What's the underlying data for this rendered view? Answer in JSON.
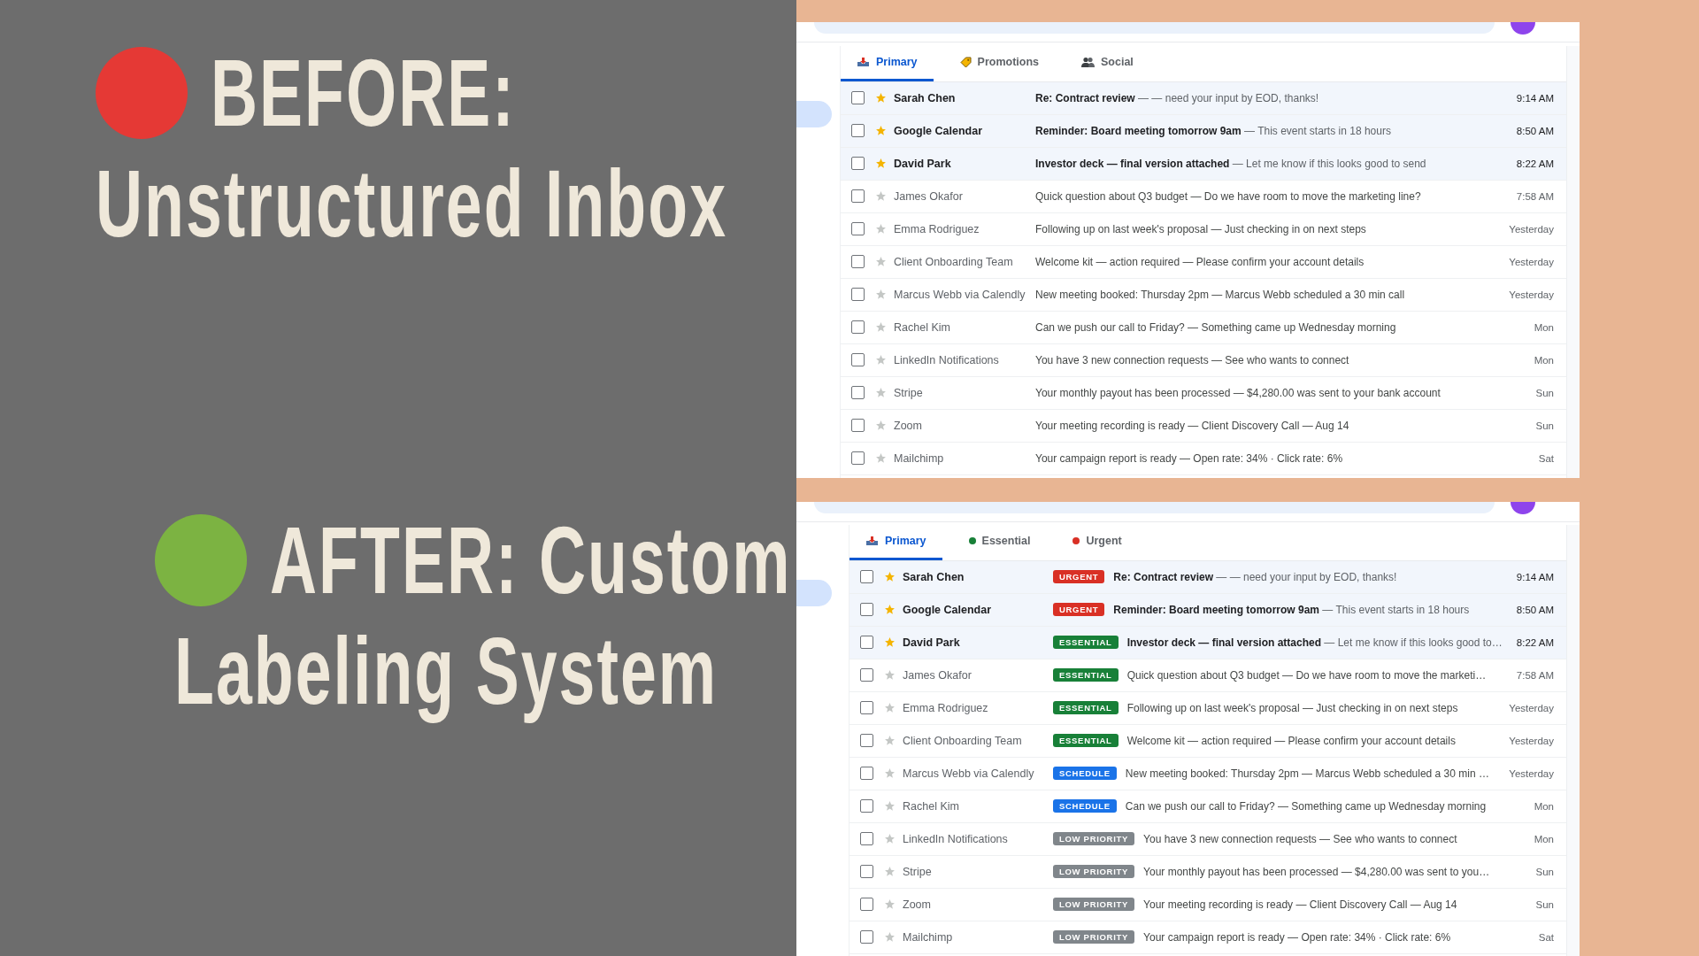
{
  "before": {
    "heading": {
      "color": "#e53935",
      "lines": [
        "BEFORE:",
        "Unstructured Inbox"
      ]
    },
    "inbox": {
      "tabs": [
        {
          "label": "Primary",
          "kind": "inbox",
          "selected": true
        },
        {
          "label": "Promotions",
          "kind": "tag",
          "selected": false
        },
        {
          "label": "Social",
          "kind": "people",
          "selected": false
        }
      ],
      "rows": [
        {
          "checked": false,
          "starred": true,
          "unread": true,
          "sender": "Sarah Chen",
          "text": "**Re: Contract review** — — need your input by EOD, thanks!",
          "time": "9:14 AM"
        },
        {
          "checked": false,
          "starred": true,
          "unread": true,
          "sender": "Google Calendar",
          "text": "**Reminder: Board meeting tomorrow 9am** — This event starts in 18 hours",
          "time": "8:50 AM"
        },
        {
          "checked": false,
          "starred": true,
          "unread": true,
          "sender": "David Park",
          "text": "**Investor deck — final version attached** — Let me know if this looks good to send",
          "time": "8:22 AM"
        },
        {
          "checked": false,
          "starred": false,
          "unread": false,
          "sender": "James Okafor",
          "text": "Quick question about Q3 budget — Do we have room to move the marketing line?",
          "time": "7:58 AM"
        },
        {
          "checked": false,
          "starred": false,
          "unread": false,
          "sender": "Emma Rodriguez",
          "text": "Following up on last week's proposal — Just checking in on next steps",
          "time": "Yesterday"
        },
        {
          "checked": false,
          "starred": false,
          "unread": false,
          "sender": "Client Onboarding Team",
          "text": "Welcome kit — action required — Please confirm your account details",
          "time": "Yesterday"
        },
        {
          "checked": false,
          "starred": false,
          "unread": false,
          "sender": "Marcus Webb via Calendly",
          "text": "New meeting booked: Thursday 2pm — Marcus Webb scheduled a 30 min call",
          "time": "Yesterday"
        },
        {
          "checked": false,
          "starred": false,
          "unread": false,
          "sender": "Rachel Kim",
          "text": "Can we push our call to Friday? — Something came up Wednesday morning",
          "time": "Mon"
        },
        {
          "checked": false,
          "starred": false,
          "unread": false,
          "sender": "LinkedIn Notifications",
          "text": "You have 3 new connection requests — See who wants to connect",
          "time": "Mon"
        },
        {
          "checked": false,
          "starred": false,
          "unread": false,
          "sender": "Stripe",
          "text": "Your monthly payout has been processed — $4,280.00 was sent to your bank account",
          "time": "Sun"
        },
        {
          "checked": false,
          "starred": false,
          "unread": false,
          "sender": "Zoom",
          "text": "Your meeting recording is ready — Client Discovery Call — Aug 14",
          "time": "Sun"
        },
        {
          "checked": false,
          "starred": false,
          "unread": false,
          "sender": "Mailchimp",
          "text": "Your campaign report is ready — Open rate: 34% · Click rate: 6%",
          "time": "Sat"
        }
      ]
    }
  },
  "after": {
    "heading": {
      "color": "#7cb342",
      "lines": [
        "AFTER: Custom",
        "Labeling System"
      ]
    },
    "inbox": {
      "tabs": [
        {
          "label": "Primary",
          "kind": "inbox",
          "selected": true
        },
        {
          "label": "Essential",
          "kind": "dot",
          "color": "#188038",
          "selected": false
        },
        {
          "label": "Urgent",
          "kind": "dot",
          "color": "#d93025",
          "selected": false
        }
      ],
      "rows": [
        {
          "checked": false,
          "starred": true,
          "unread": true,
          "sender": "Sarah Chen",
          "label": {
            "text": "URGENT",
            "color": "#d93025"
          },
          "text": "**Re: Contract review** — — need your input by EOD, thanks!",
          "time": "9:14 AM"
        },
        {
          "checked": false,
          "starred": true,
          "unread": true,
          "sender": "Google Calendar",
          "label": {
            "text": "URGENT",
            "color": "#d93025"
          },
          "text": "**Reminder: Board meeting tomorrow 9am** — This event starts in 18 hours",
          "time": "8:50 AM"
        },
        {
          "checked": false,
          "starred": true,
          "unread": true,
          "sender": "David Park",
          "label": {
            "text": "ESSENTIAL",
            "color": "#188038"
          },
          "text": "**Investor deck — final version attached** — Let me know if this looks good to…",
          "time": "8:22 AM"
        },
        {
          "checked": false,
          "starred": false,
          "unread": false,
          "sender": "James Okafor",
          "label": {
            "text": "ESSENTIAL",
            "color": "#188038"
          },
          "text": "Quick question about Q3 budget — Do we have room to move the marketi…",
          "time": "7:58 AM"
        },
        {
          "checked": false,
          "starred": false,
          "unread": false,
          "sender": "Emma Rodriguez",
          "label": {
            "text": "ESSENTIAL",
            "color": "#188038"
          },
          "text": "Following up on last week's proposal — Just checking in on next steps",
          "time": "Yesterday"
        },
        {
          "checked": false,
          "starred": false,
          "unread": false,
          "sender": "Client Onboarding Team",
          "label": {
            "text": "ESSENTIAL",
            "color": "#188038"
          },
          "text": "Welcome kit — action required — Please confirm your account details",
          "time": "Yesterday"
        },
        {
          "checked": false,
          "starred": false,
          "unread": false,
          "sender": "Marcus Webb via Calendly",
          "label": {
            "text": "SCHEDULE",
            "color": "#1a73e8"
          },
          "text": "New meeting booked: Thursday 2pm — Marcus Webb scheduled a 30 min …",
          "time": "Yesterday"
        },
        {
          "checked": false,
          "starred": false,
          "unread": false,
          "sender": "Rachel Kim",
          "label": {
            "text": "SCHEDULE",
            "color": "#1a73e8"
          },
          "text": "Can we push our call to Friday? — Something came up Wednesday morning",
          "time": "Mon"
        },
        {
          "checked": false,
          "starred": false,
          "unread": false,
          "sender": "LinkedIn Notifications",
          "label": {
            "text": "LOW PRIORITY",
            "color": "#80868b"
          },
          "text": "You have 3 new connection requests — See who wants to connect",
          "time": "Mon"
        },
        {
          "checked": false,
          "starred": false,
          "unread": false,
          "sender": "Stripe",
          "label": {
            "text": "LOW PRIORITY",
            "color": "#80868b"
          },
          "text": "Your monthly payout has been processed — $4,280.00 was sent to you…",
          "time": "Sun"
        },
        {
          "checked": false,
          "starred": false,
          "unread": false,
          "sender": "Zoom",
          "label": {
            "text": "LOW PRIORITY",
            "color": "#80868b"
          },
          "text": "Your meeting recording is ready — Client Discovery Call — Aug 14",
          "time": "Sun"
        },
        {
          "checked": false,
          "starred": false,
          "unread": false,
          "sender": "Mailchimp",
          "label": {
            "text": "LOW PRIORITY",
            "color": "#80868b"
          },
          "text": "Your campaign report is ready — Open rate: 34% · Click rate: 6%",
          "time": "Sat"
        }
      ]
    }
  }
}
